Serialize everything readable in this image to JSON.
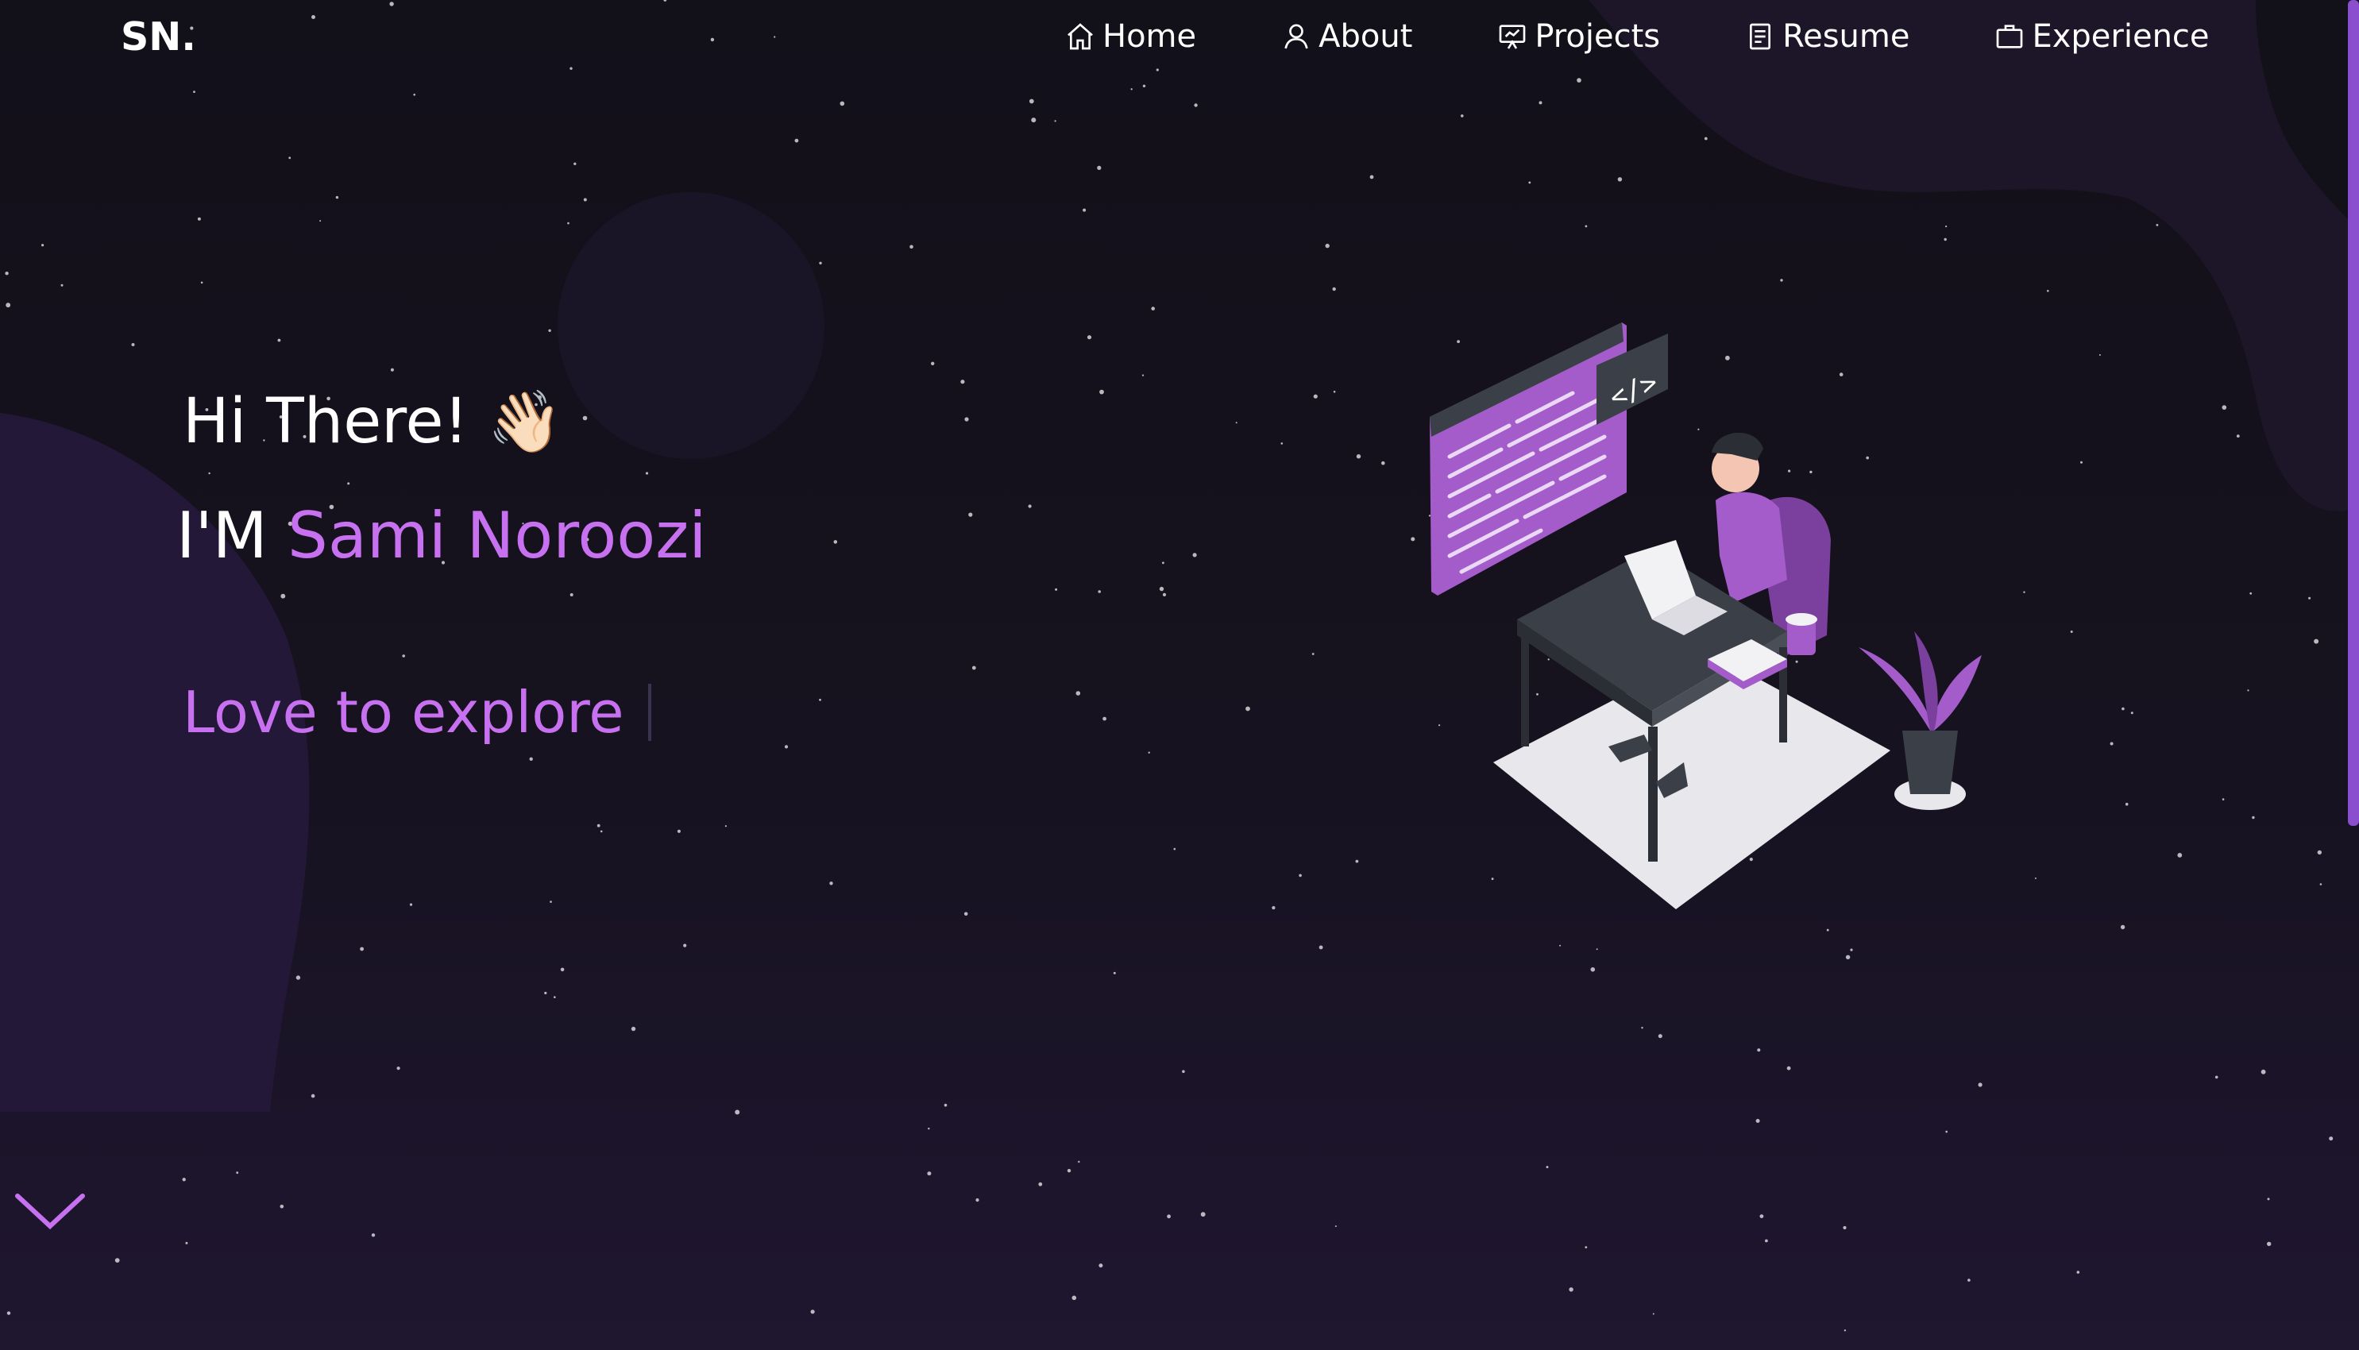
{
  "brand": {
    "logo_text": "SN."
  },
  "nav": {
    "items": [
      {
        "label": "Home",
        "icon": "home-icon"
      },
      {
        "label": "About",
        "icon": "user-icon"
      },
      {
        "label": "Projects",
        "icon": "presentation-icon"
      },
      {
        "label": "Resume",
        "icon": "document-icon"
      },
      {
        "label": "Experience",
        "icon": "briefcase-icon"
      }
    ]
  },
  "hero": {
    "greeting": "Hi There!",
    "greeting_emoji": "👋🏻",
    "intro_prefix": "I'M",
    "name": "Sami Noroozi",
    "typed_text": "Love to explore"
  },
  "illustration": {
    "code_tag": "</>"
  },
  "colors": {
    "accent": "#c770f0",
    "background": "#121019",
    "illustration_purple": "#a35cc9"
  }
}
